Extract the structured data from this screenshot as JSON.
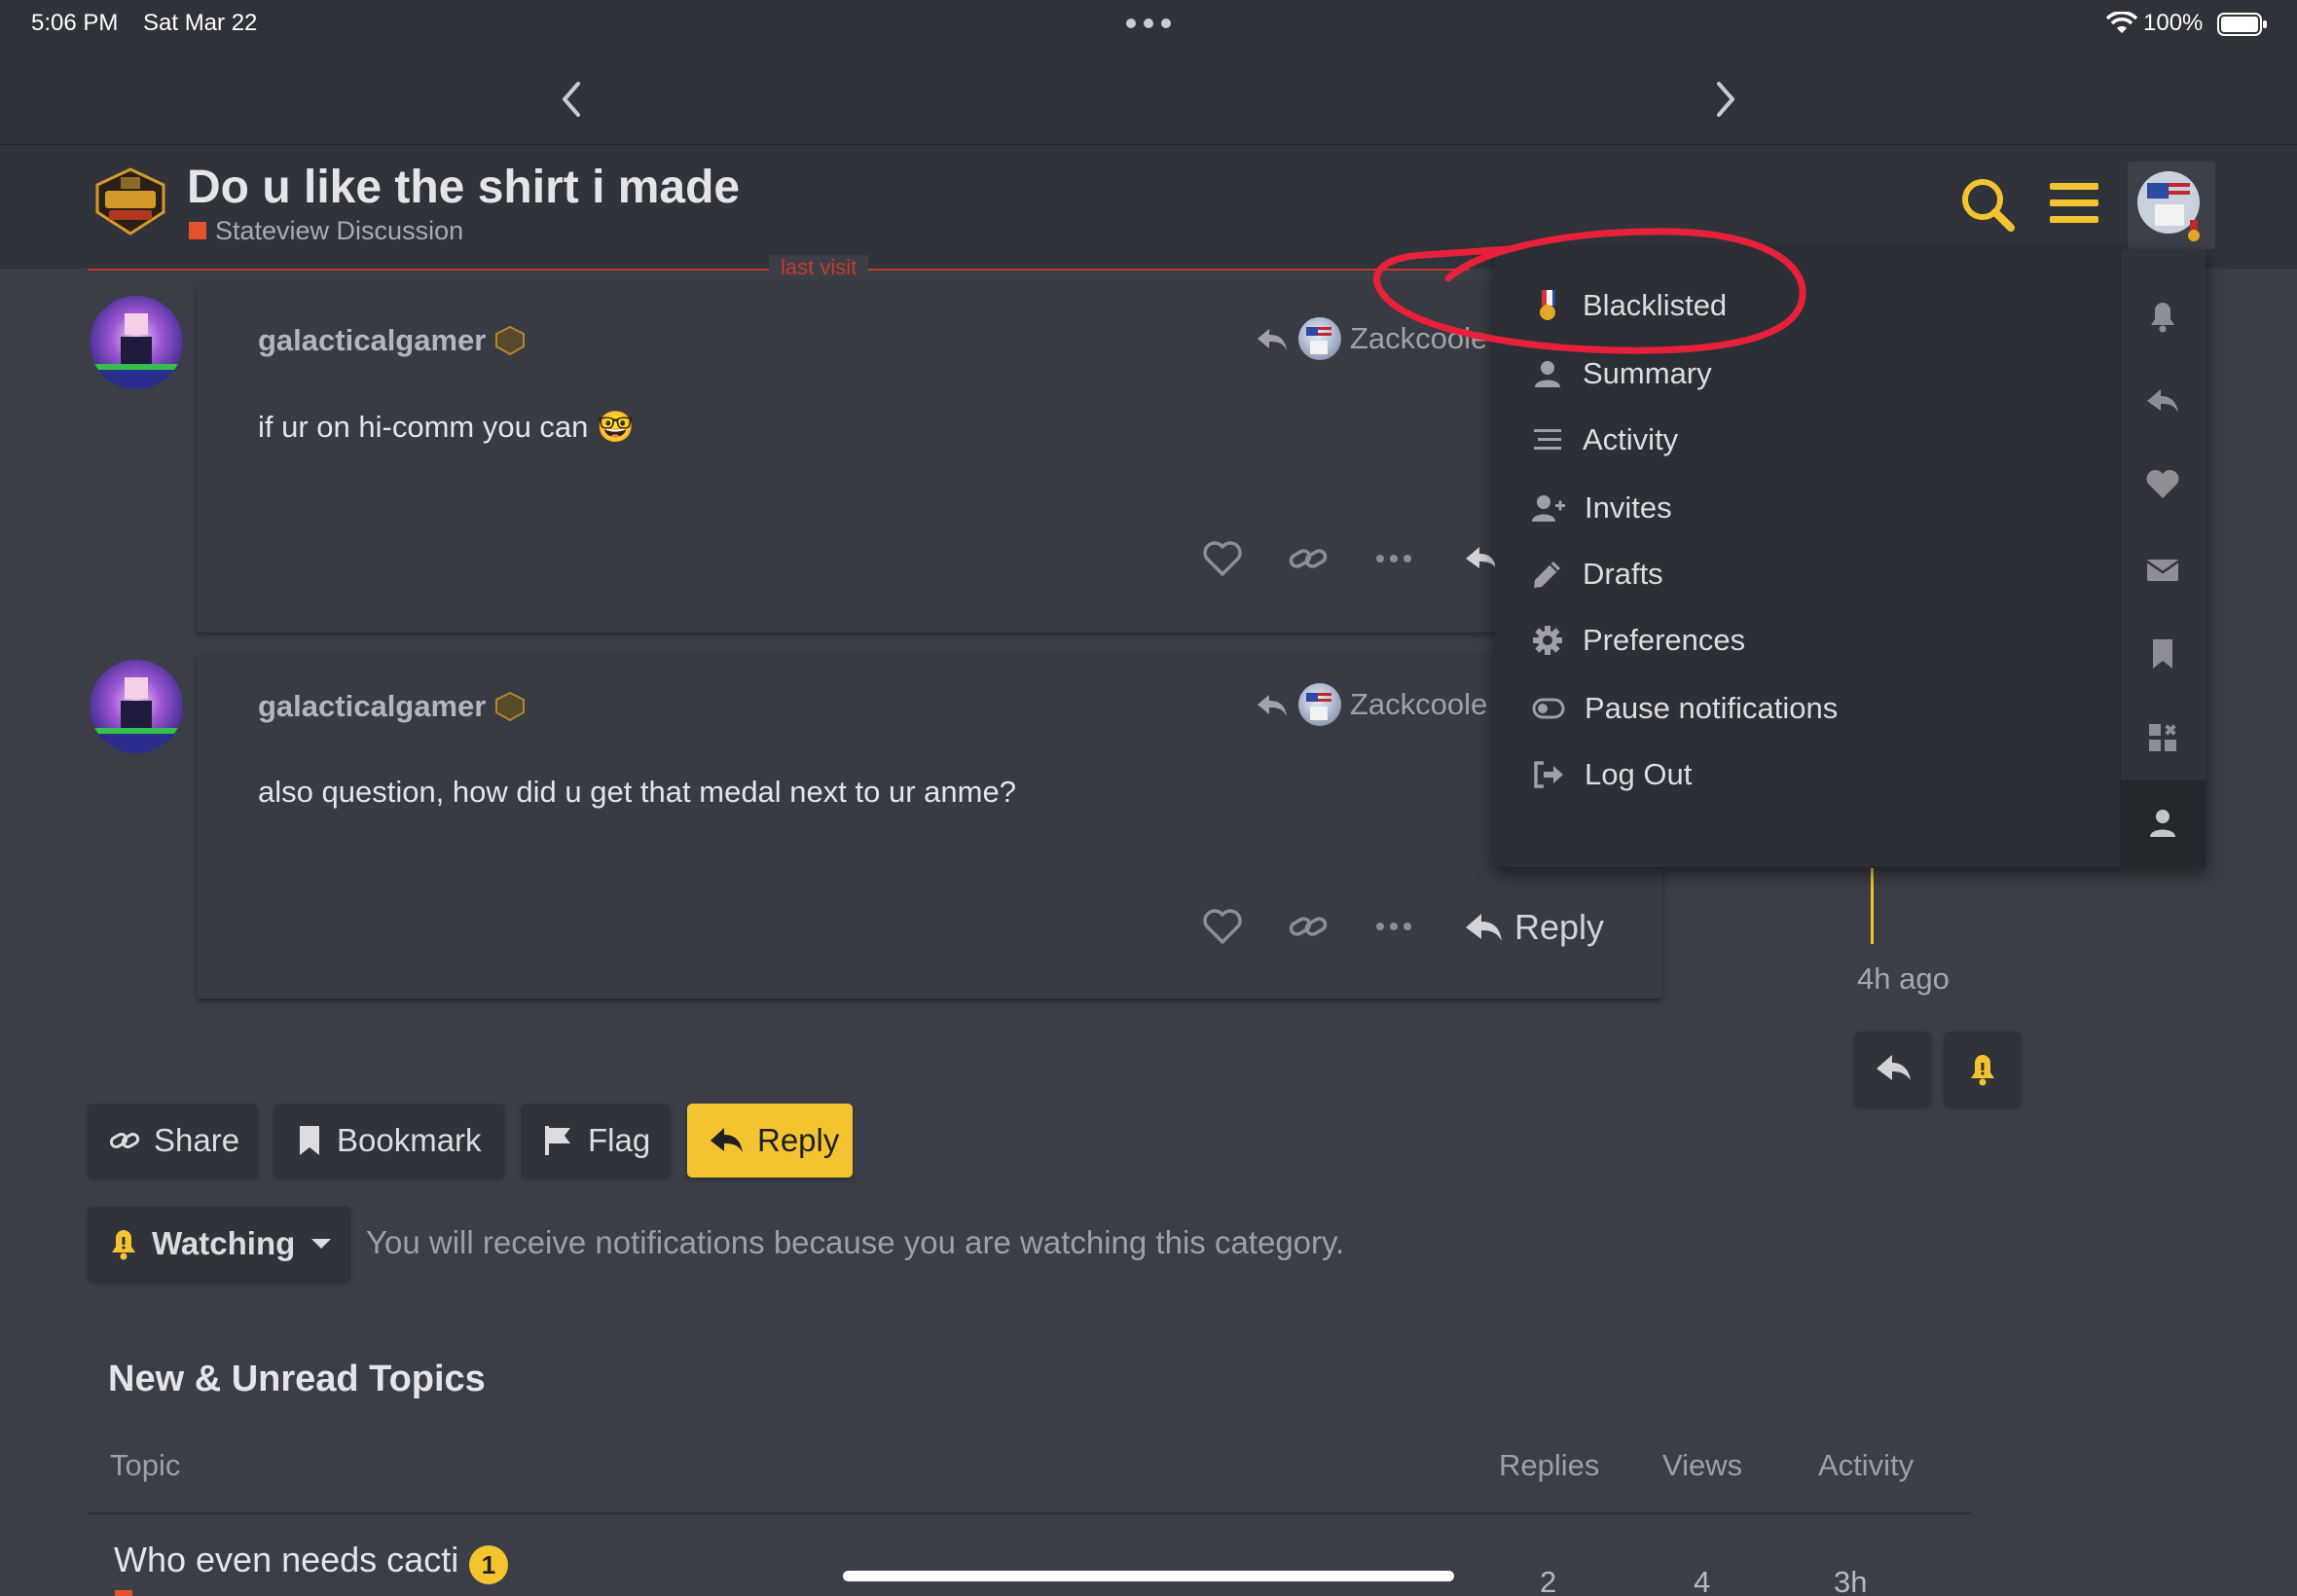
{
  "status_bar": {
    "time": "5:06 PM",
    "date": "Sat Mar 22",
    "battery": "100%"
  },
  "topic": {
    "title": "Do u like the shirt i made",
    "category": "Stateview Discussion",
    "last_visit": "last visit",
    "category_color": "#e5532d"
  },
  "posts": [
    {
      "username": "galacticalgamer",
      "text": "if ur on hi-comm you can 🤓",
      "reply_to": "Zackcoole"
    },
    {
      "username": "galacticalgamer",
      "text": "also question, how did u get that medal next to ur anme?",
      "reply_to": "Zackcoole",
      "reply_label": "Reply"
    }
  ],
  "timeline": {
    "ago": "4h ago"
  },
  "actions": {
    "share": "Share",
    "bookmark": "Bookmark",
    "flag": "Flag",
    "reply": "Reply"
  },
  "notifications": {
    "level": "Watching",
    "note": "You will receive notifications because you are watching this category."
  },
  "new_unread": {
    "title": "New & Unread Topics",
    "columns": [
      "Topic",
      "Replies",
      "Views",
      "Activity"
    ],
    "rows": [
      {
        "title": "Who even needs cacti",
        "unread": "1",
        "replies": "2",
        "views": "4",
        "activity": "3h"
      }
    ]
  },
  "user_menu": {
    "items": [
      {
        "label": "Blacklisted",
        "icon": "medal-icon"
      },
      {
        "label": "Summary",
        "icon": "user-icon"
      },
      {
        "label": "Activity",
        "icon": "stream-icon"
      },
      {
        "label": "Invites",
        "icon": "user-plus-icon"
      },
      {
        "label": "Drafts",
        "icon": "pencil-icon"
      },
      {
        "label": "Preferences",
        "icon": "gear-icon"
      },
      {
        "label": "Pause notifications",
        "icon": "toggle-icon"
      },
      {
        "label": "Log Out",
        "icon": "sign-out-icon"
      }
    ],
    "rail": [
      "bell-icon",
      "reply-icon",
      "heart-icon",
      "envelope-icon",
      "bookmark-icon",
      "grid-plus-icon",
      "user-icon"
    ]
  },
  "colors": {
    "accent": "#f4c430",
    "background": "#3b3e46",
    "header": "#30333a",
    "annotation": "#e8213a"
  }
}
